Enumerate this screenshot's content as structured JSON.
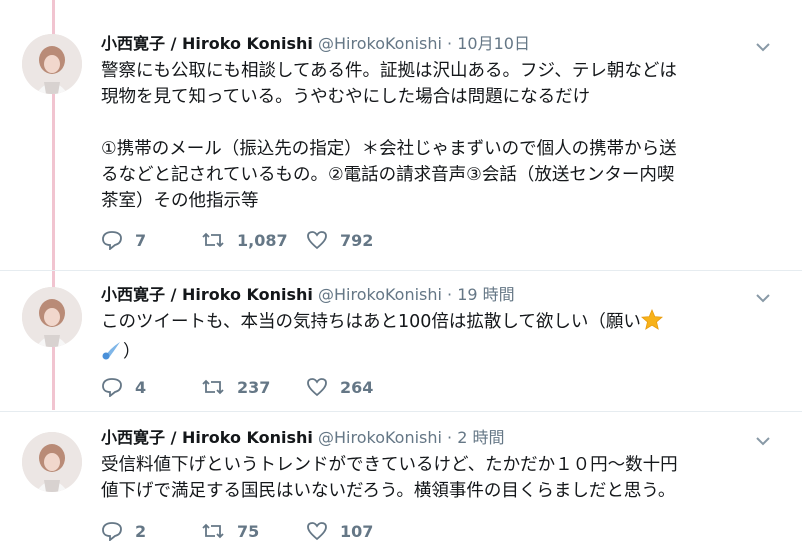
{
  "tweets": [
    {
      "name": "小西寛子 / Hiroko Konishi",
      "handle": "@HirokoKonishi",
      "sep": " · ",
      "time": "10月10日",
      "text": "警察にも公取にも相談してある件。証拠は沢山ある。フジ、テレ朝などは\n現物を見て知っている。うやむやにした場合は問題になるだけ\n\n①携帯のメール（振込先の指定）＊会社じゃまずいので個人の携帯から送\nるなどと記されているもの。②電話の請求音声③会話（放送センター内喫\n茶室）その他指示等",
      "replies": "7",
      "retweets": "1,087",
      "likes": "792"
    },
    {
      "name": "小西寛子 / Hiroko Konishi",
      "handle": "@HirokoKonishi",
      "sep": " · ",
      "time": "19 時間",
      "text_line1": "このツイートも、本当の気持ちはあと100倍は拡散して欲しい（願い",
      "text_line2": "）",
      "replies": "4",
      "retweets": "237",
      "likes": "264"
    },
    {
      "name": "小西寛子 / Hiroko Konishi",
      "handle": "@HirokoKonishi",
      "sep": " · ",
      "time": "2 時間",
      "text": "受信料値下げというトレンドができているけど、たかだか１０円〜数十円\n値下げで満足する国民はいないだろう。横領事件の目くらましだと思う。",
      "replies": "2",
      "retweets": "75",
      "likes": "107"
    }
  ],
  "colors": {
    "thread_line": "#f1c4d0",
    "muted": "#657786",
    "text": "#14171a",
    "divider": "#e6ecf0"
  },
  "icons": [
    "reply-icon",
    "retweet-icon",
    "like-icon",
    "caret-down-icon",
    "star-emoji",
    "comet-emoji"
  ]
}
